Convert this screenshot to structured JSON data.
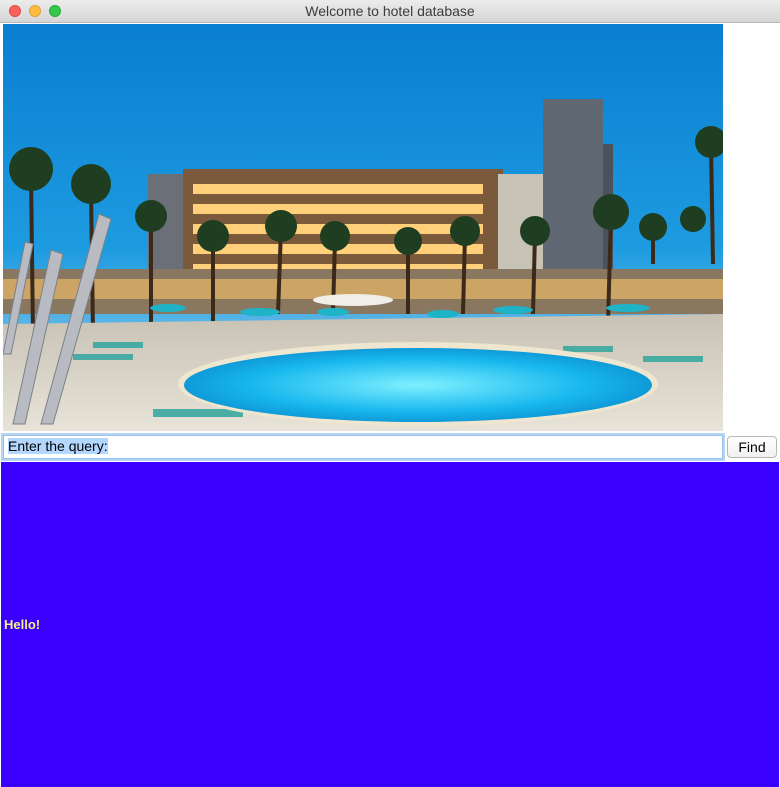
{
  "window": {
    "title": "Welcome to hotel database"
  },
  "hero_image": {
    "description_name": "hotel-pool-photo"
  },
  "query": {
    "value": "Enter the query:",
    "find_label": "Find"
  },
  "result": {
    "text": "Hello!",
    "background_color": "#3a00ff",
    "text_color": "#f5f08a"
  }
}
